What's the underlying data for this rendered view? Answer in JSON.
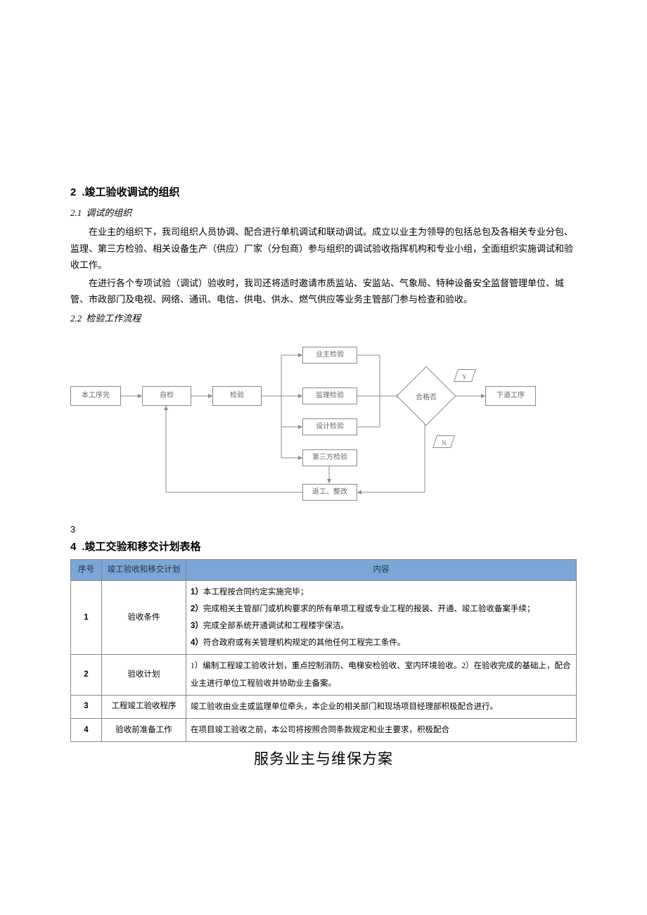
{
  "section2": {
    "num": "2",
    "title": ".竣工验收调试的组织",
    "sub21_num": "2.1",
    "sub21_title": "调试的组织",
    "p1": "在业主的组织下，我司组织人员协调、配合进行单机调试和联动调试。成立以业主为领导的包括总包及各相关专业分包、监理、第三方检验、相关设备生产（供应）厂家（分包商）参与组织的调试验收指挥机构和专业小组，全面组织实施调试和验收工作。",
    "p2": "在进行各个专项试验（调试）验收时，我司还将适时邀请市质监站、安监站、气象局、特种设备安全监督管理单位、城管、市政部门及电视、网络、通讯、电信、供电、供水、燃气供应等业务主管部门参与检查和验收。",
    "sub22_num": "2.2",
    "sub22_title": "检验工作流程"
  },
  "flow": {
    "b1": "本工序完",
    "b2": "自检",
    "b3": "检验",
    "b4": "业主检验",
    "b5": "监理检验",
    "b6": "设计检验",
    "b7": "第三方检验",
    "b8": "返工、整改",
    "d1": "合格否",
    "y": "Y",
    "n": "N",
    "b9": "下道工序"
  },
  "markers": {
    "m3": "3",
    "m4_num": "4",
    "m4_title": ".竣工交验和移交计划表格"
  },
  "table": {
    "h1": "序号",
    "h2": "竣工验收和移交计划",
    "h3": "内容",
    "rows": [
      {
        "seq": "1",
        "plan": "验收条件",
        "content": "1）本工程按合同约定实施完毕；\n2）完成相关主管部门或机构要求的所有单项工程或专业工程的报装、开通、竣工验收备案手续；\n3）完成全部系统开通调试和工程楼宇保洁。\n4）符合政府或有关管理机构规定的其他任何工程完工条件。"
      },
      {
        "seq": "2",
        "plan": "验收计划",
        "content": "1）编制工程竣工验收计划，重点控制消防、电梯安检验收、室内环境验收。2）在验收完成的基础上，配合业主进行单位工程验收并协助业主备案。"
      },
      {
        "seq": "3",
        "plan": "工程竣工验收程序",
        "content": "竣工验收由业主或监理单位牵头，本企业的相关部门和现场项目经理部积极配合进行。"
      },
      {
        "seq": "4",
        "plan": "验收前准备工作",
        "content": "在项目竣工验收之前，本公司将按照合同条款规定和业主要求，积极配合"
      }
    ]
  },
  "bigTitle": "服务业主与维保方案"
}
